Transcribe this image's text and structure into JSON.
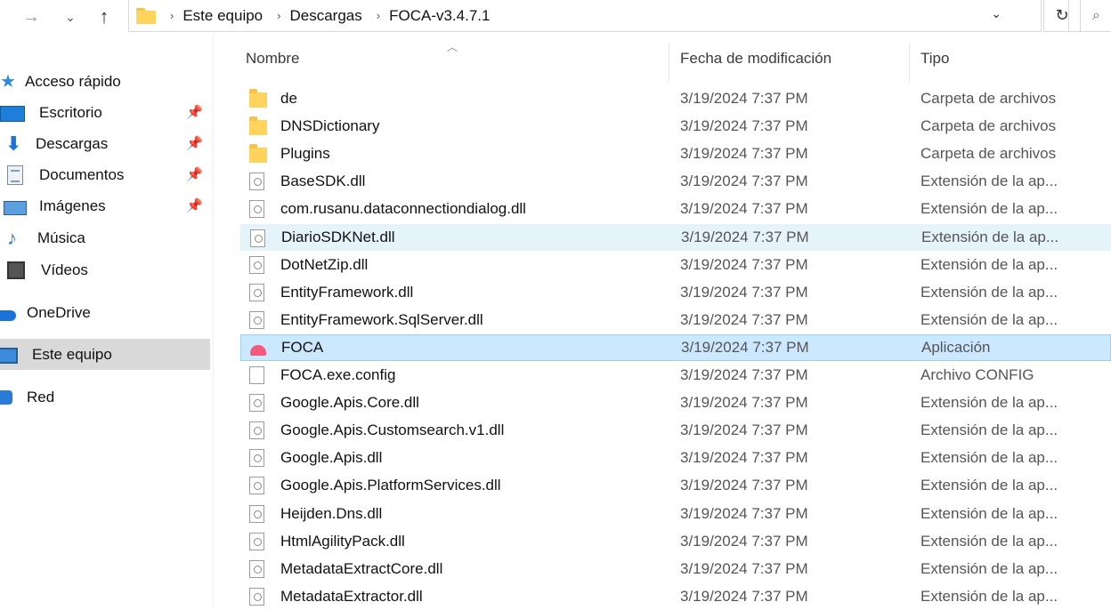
{
  "address_bar": {
    "crumbs": [
      "Este equipo",
      "Descargas",
      "FOCA-v3.4.7.1"
    ]
  },
  "sidebar": {
    "items": [
      {
        "label": "Acceso rápido",
        "icon": "quick-access-star-icon"
      },
      {
        "label": "Escritorio",
        "icon": "desktop-icon",
        "pinned": true
      },
      {
        "label": "Descargas",
        "icon": "downloads-icon",
        "pinned": true
      },
      {
        "label": "Documentos",
        "icon": "documents-icon",
        "pinned": true
      },
      {
        "label": "Imágenes",
        "icon": "pictures-icon",
        "pinned": true
      },
      {
        "label": "Música",
        "icon": "music-icon"
      },
      {
        "label": "Vídeos",
        "icon": "videos-icon"
      },
      {
        "label": "OneDrive",
        "icon": "onedrive-cloud-icon"
      },
      {
        "label": "Este equipo",
        "icon": "this-pc-icon",
        "selected": true
      },
      {
        "label": "Red",
        "icon": "network-icon"
      }
    ]
  },
  "columns": {
    "name": "Nombre",
    "date": "Fecha de modificación",
    "type": "Tipo"
  },
  "files": [
    {
      "name": "de",
      "date": "3/19/2024 7:37 PM",
      "type": "Carpeta de archivos",
      "kind": "folder"
    },
    {
      "name": "DNSDictionary",
      "date": "3/19/2024 7:37 PM",
      "type": "Carpeta de archivos",
      "kind": "folder"
    },
    {
      "name": "Plugins",
      "date": "3/19/2024 7:37 PM",
      "type": "Carpeta de archivos",
      "kind": "folder"
    },
    {
      "name": "BaseSDK.dll",
      "date": "3/19/2024 7:37 PM",
      "type": "Extensión de la ap...",
      "kind": "dll"
    },
    {
      "name": "com.rusanu.dataconnectiondialog.dll",
      "date": "3/19/2024 7:37 PM",
      "type": "Extensión de la ap...",
      "kind": "dll"
    },
    {
      "name": "DiarioSDKNet.dll",
      "date": "3/19/2024 7:37 PM",
      "type": "Extensión de la ap...",
      "kind": "dll",
      "state": "hover"
    },
    {
      "name": "DotNetZip.dll",
      "date": "3/19/2024 7:37 PM",
      "type": "Extensión de la ap...",
      "kind": "dll"
    },
    {
      "name": "EntityFramework.dll",
      "date": "3/19/2024 7:37 PM",
      "type": "Extensión de la ap...",
      "kind": "dll"
    },
    {
      "name": "EntityFramework.SqlServer.dll",
      "date": "3/19/2024 7:37 PM",
      "type": "Extensión de la ap...",
      "kind": "dll"
    },
    {
      "name": "FOCA",
      "date": "3/19/2024 7:37 PM",
      "type": "Aplicación",
      "kind": "app",
      "state": "selected"
    },
    {
      "name": "FOCA.exe.config",
      "date": "3/19/2024 7:37 PM",
      "type": "Archivo CONFIG",
      "kind": "config"
    },
    {
      "name": "Google.Apis.Core.dll",
      "date": "3/19/2024 7:37 PM",
      "type": "Extensión de la ap...",
      "kind": "dll"
    },
    {
      "name": "Google.Apis.Customsearch.v1.dll",
      "date": "3/19/2024 7:37 PM",
      "type": "Extensión de la ap...",
      "kind": "dll"
    },
    {
      "name": "Google.Apis.dll",
      "date": "3/19/2024 7:37 PM",
      "type": "Extensión de la ap...",
      "kind": "dll"
    },
    {
      "name": "Google.Apis.PlatformServices.dll",
      "date": "3/19/2024 7:37 PM",
      "type": "Extensión de la ap...",
      "kind": "dll"
    },
    {
      "name": "Heijden.Dns.dll",
      "date": "3/19/2024 7:37 PM",
      "type": "Extensión de la ap...",
      "kind": "dll"
    },
    {
      "name": "HtmlAgilityPack.dll",
      "date": "3/19/2024 7:37 PM",
      "type": "Extensión de la ap...",
      "kind": "dll"
    },
    {
      "name": "MetadataExtractCore.dll",
      "date": "3/19/2024 7:37 PM",
      "type": "Extensión de la ap...",
      "kind": "dll"
    },
    {
      "name": "MetadataExtractor.dll",
      "date": "3/19/2024 7:37 PM",
      "type": "Extensión de la ap...",
      "kind": "dll"
    }
  ]
}
